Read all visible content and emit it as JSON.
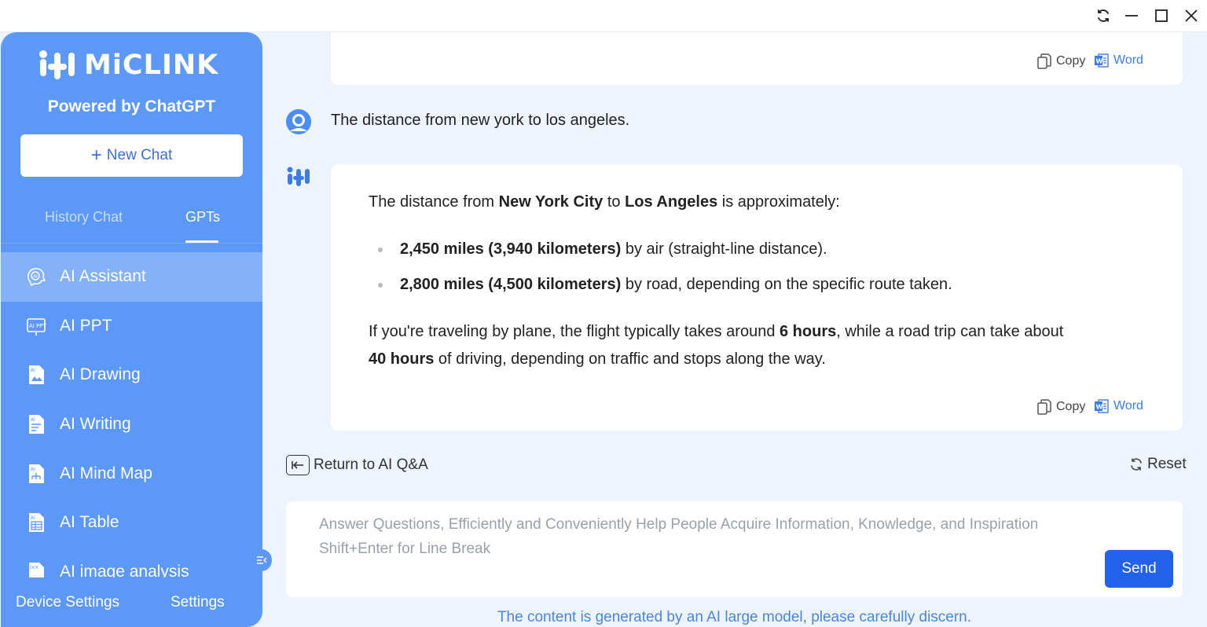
{
  "window": {
    "controls": [
      "refresh-icon",
      "minimize-icon",
      "maximize-icon",
      "close-icon"
    ]
  },
  "sidebar": {
    "brand": "MiCLINK",
    "powered_by": "Powered by ChatGPT",
    "new_chat_label": "New Chat",
    "tabs": [
      {
        "label": "History Chat",
        "active": false
      },
      {
        "label": "GPTs",
        "active": true
      }
    ],
    "items": [
      {
        "label": "AI Assistant",
        "icon": "ai-assistant-icon",
        "active": true
      },
      {
        "label": "AI PPT",
        "icon": "ai-ppt-icon",
        "active": false
      },
      {
        "label": "AI Drawing",
        "icon": "ai-drawing-icon",
        "active": false
      },
      {
        "label": "AI Writing",
        "icon": "ai-writing-icon",
        "active": false
      },
      {
        "label": "AI Mind Map",
        "icon": "ai-mind-map-icon",
        "active": false
      },
      {
        "label": "AI Table",
        "icon": "ai-table-icon",
        "active": false
      },
      {
        "label": "AI image analysis",
        "icon": "ai-image-analysis-icon",
        "active": false
      }
    ],
    "device_settings_label": "Device Settings",
    "settings_label": "Settings"
  },
  "chat": {
    "copy_label": "Copy",
    "word_label": "Word",
    "user_question": "The distance from new york to los angeles.",
    "answer": {
      "intro_pre": "The distance from ",
      "intro_city1": "New York City",
      "intro_mid": " to ",
      "intro_city2": "Los Angeles",
      "intro_post": " is approximately:",
      "bullets": [
        {
          "bold": "2,450 miles (3,940 kilometers)",
          "rest": " by air (straight-line distance)."
        },
        {
          "bold": "2,800 miles (4,500 kilometers)",
          "rest": " by road, depending on the specific route taken."
        }
      ],
      "para_pre": "If you're traveling by plane, the flight typically takes around ",
      "para_bold1": "6 hours",
      "para_mid": ", while a road trip can take about",
      "para_bold2": "40 hours",
      "para_post": " of driving, depending on traffic and stops along the way."
    }
  },
  "controls": {
    "return_label": "Return to AI Q&A",
    "reset_label": "Reset"
  },
  "input": {
    "placeholder_line1": "Answer Questions, Efficiently and Conveniently Help People Acquire Information, Knowledge, and Inspiration",
    "placeholder_line2": "Shift+Enter for Line Break",
    "send_label": "Send"
  },
  "disclaimer": "The content is generated by an AI large model, please carefully discern.",
  "colors": {
    "sidebar": "#5c98f7",
    "sidebar_active": "#83b2fa",
    "background": "#eef4fe",
    "primary": "#2262ea",
    "link": "#3b7be8"
  }
}
